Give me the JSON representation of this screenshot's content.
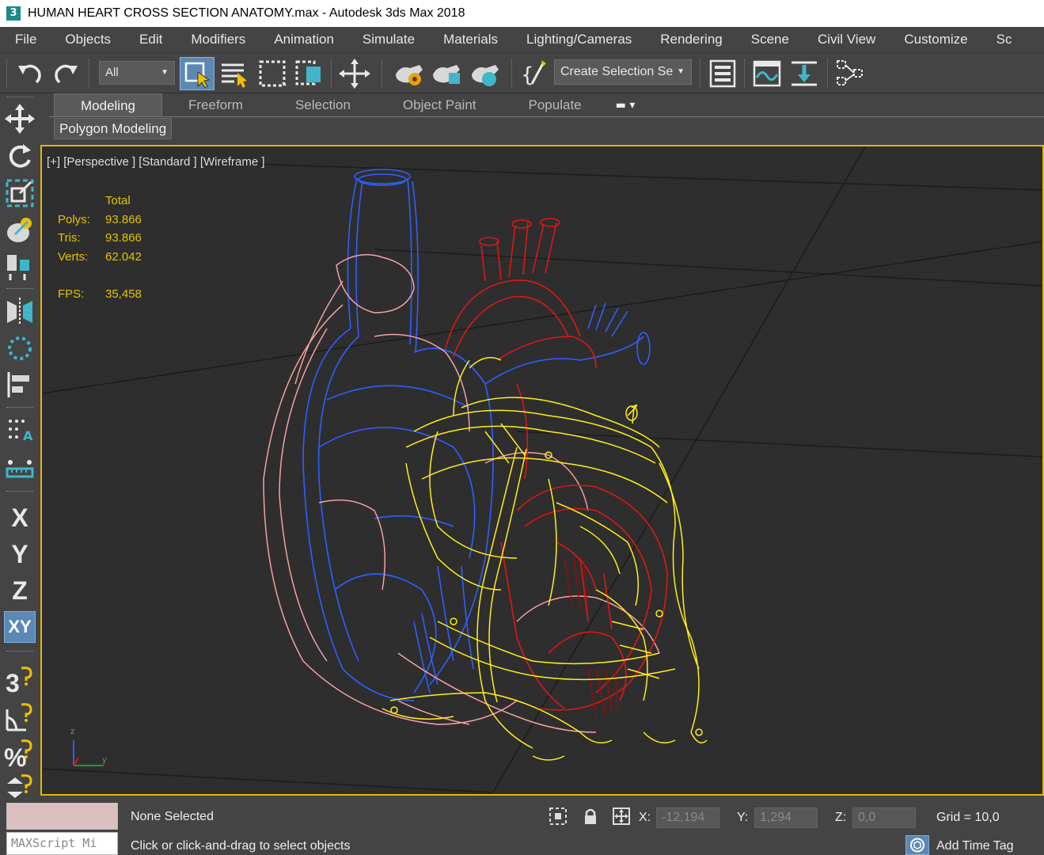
{
  "window": {
    "app_icon_glyph": "3",
    "title": "HUMAN HEART CROSS SECTION ANATOMY.max - Autodesk 3ds Max 2018"
  },
  "menu": [
    "File",
    "Objects",
    "Edit",
    "Modifiers",
    "Animation",
    "Simulate",
    "Materials",
    "Lighting/Cameras",
    "Rendering",
    "Scene",
    "Civil View",
    "Customize",
    "Sc"
  ],
  "toolbar": {
    "filter_value": "All",
    "named_selection_placeholder": "Create Selection Se",
    "icons": [
      "undo-icon",
      "redo-icon",
      "select-object-icon",
      "select-by-name-icon",
      "rectangular-selection-icon",
      "window-crossing-icon",
      "select-and-move-icon",
      "render-setup-icon",
      "rendered-frame-window-icon",
      "render-production-icon",
      "script-editor-icon",
      "layer-explorer-icon",
      "curve-editor-icon",
      "dope-sheet-icon",
      "schematic-view-icon"
    ]
  },
  "ribbon": {
    "tabs": [
      "Modeling",
      "Freeform",
      "Selection",
      "Object Paint",
      "Populate"
    ],
    "active_tab": "Modeling",
    "panel_button": "Polygon Modeling"
  },
  "command_toolbar": {
    "axis_buttons": [
      "X",
      "Y",
      "Z",
      "XY"
    ],
    "active_axis": "XY",
    "snap_labels": [
      "3",
      "%"
    ]
  },
  "viewport": {
    "label": "[+] [Perspective ] [Standard ] [Wireframe ]",
    "stats": {
      "header": "Total",
      "polys_label": "Polys:",
      "polys_value": "93.866",
      "tris_label": "Tris:",
      "tris_value": "93.866",
      "verts_label": "Verts:",
      "verts_value": "62.042",
      "fps_label": "FPS:",
      "fps_value": "35,458"
    },
    "axis_gizmo": {
      "z": "z",
      "y": "y"
    },
    "colors": {
      "background": "#2e2e2e",
      "border": "#e6b700",
      "stats_text": "#e3c300",
      "wire_blue": "#2f5fff",
      "wire_red": "#e01616",
      "wire_pink": "#f4a0a0",
      "wire_yellow": "#ffef1a"
    }
  },
  "statusbar": {
    "selection_status": "None Selected",
    "prompt": "Click or click-and-drag to select objects",
    "maxscript_placeholder": "MAXScript Mi",
    "x_label": "X:",
    "x_value": "-12,194",
    "y_label": "Y:",
    "y_value": "1,294",
    "z_label": "Z:",
    "z_value": "0,0",
    "grid": "Grid = 10,0",
    "time_tag": "Add Time Tag"
  }
}
